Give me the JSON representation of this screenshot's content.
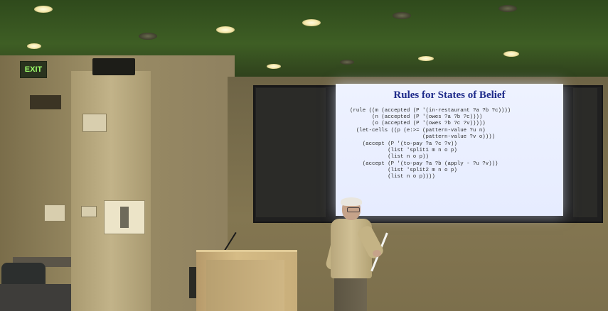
{
  "exit_sign": {
    "text": "EXIT"
  },
  "slide": {
    "title": "Rules for States of Belief",
    "code_lines": [
      "(rule ((m (accepted (P '(in-restaurant ?a ?b ?c))))",
      "       (n (accepted (P '(owes ?a ?b ?c))))",
      "       (o (accepted (P '(owes ?b ?c ?v)))))",
      "  (let-cells ((p (e:>= (pattern-value ?u n)",
      "                       (pattern-value ?v o))))",
      "    (accept (P '(to-pay ?a ?c ?v))",
      "            (list 'split1 m n o p)",
      "            (list n o p))",
      "    (accept (P '(to-pay ?a ?b (apply - ?u ?v)))",
      "            (list 'split2 m n o p)",
      "            (list n o p))))"
    ]
  },
  "colors": {
    "ceiling": "#3e5e24",
    "slide_title": "#1e2b8a",
    "slide_bg": "#eef2ff"
  }
}
